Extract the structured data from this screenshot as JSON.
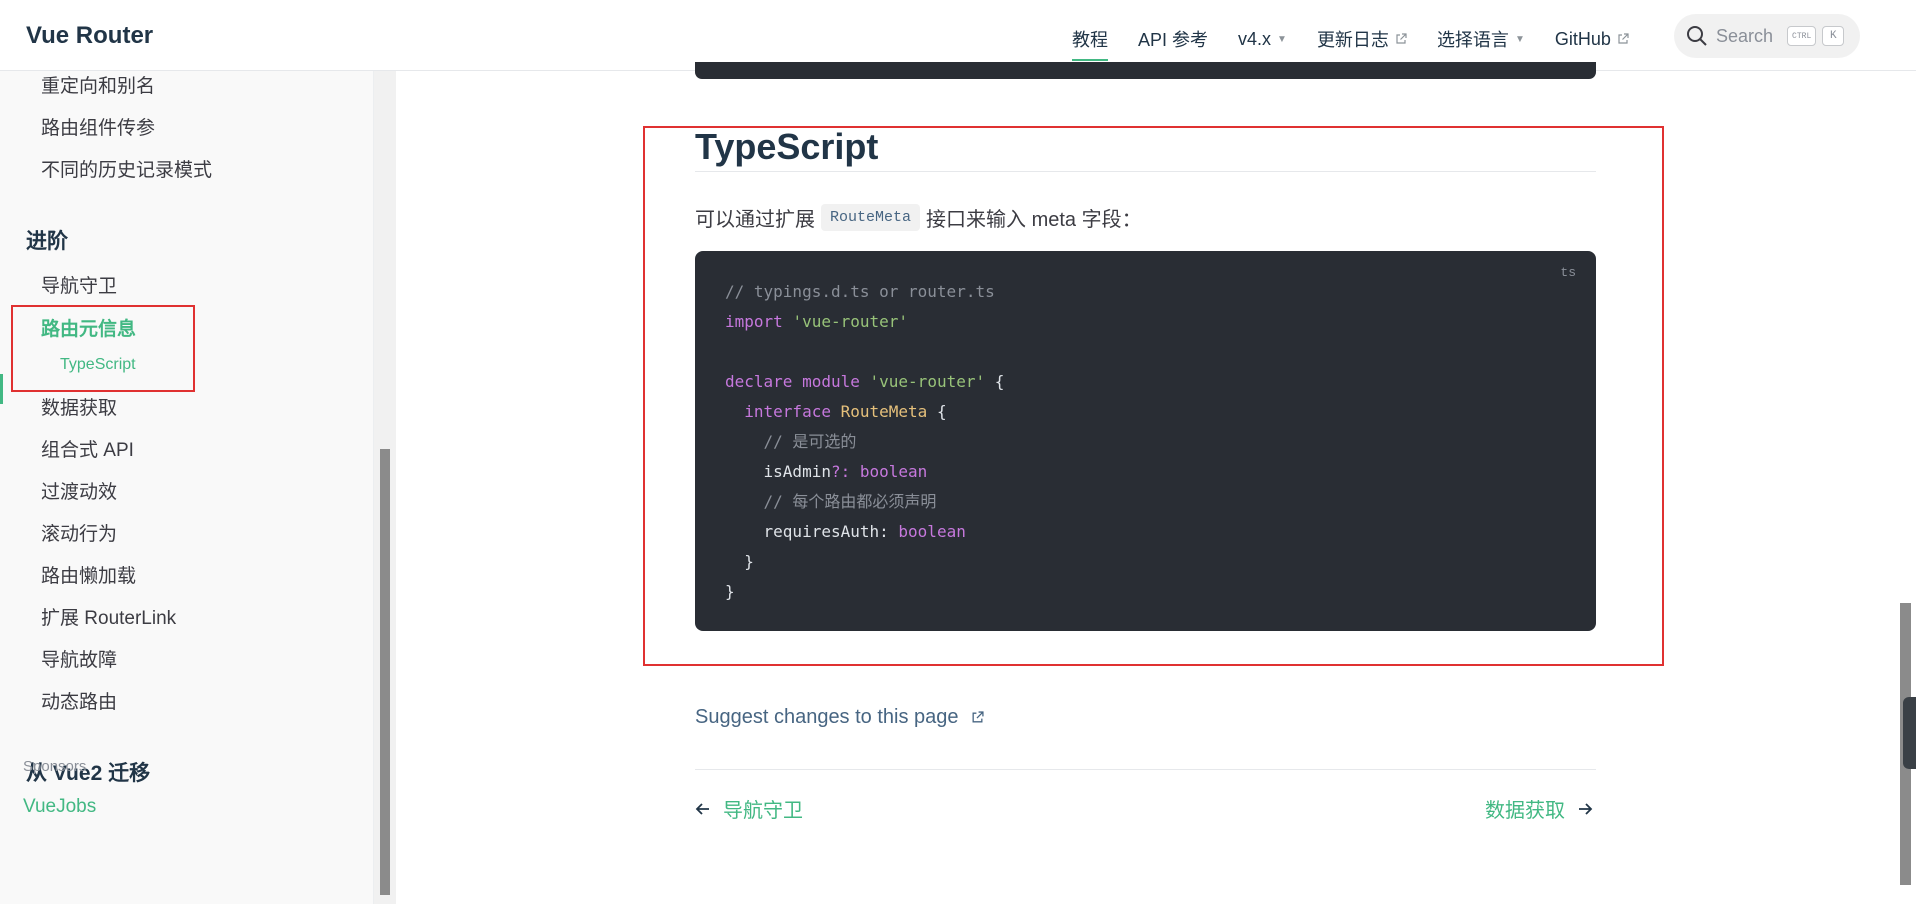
{
  "header": {
    "site_title": "Vue Router",
    "nav": [
      {
        "label": "教程",
        "active": true
      },
      {
        "label": "API 参考"
      },
      {
        "label": "v4.x",
        "dropdown": true
      },
      {
        "label": "更新日志",
        "external": true
      },
      {
        "label": "选择语言",
        "dropdown": true
      },
      {
        "label": "GitHub",
        "external": true
      }
    ],
    "search": {
      "placeholder": "Search",
      "key1": "CTRL",
      "key2": "K"
    }
  },
  "sidebar": {
    "items_top": [
      "重定向和别名",
      "路由组件传参",
      "不同的历史记录模式"
    ],
    "group_advanced": "进阶",
    "advanced_items": [
      "导航守卫",
      "路由元信息",
      "数据获取",
      "组合式 API",
      "过渡动效",
      "滚动行为",
      "路由懒加载",
      "扩展 RouterLink",
      "导航故障",
      "动态路由"
    ],
    "active_sub": "TypeScript",
    "group_migration": "从 Vue2 迁移",
    "sponsors_label": "Sponsors",
    "sponsor": "VueJobs"
  },
  "main": {
    "heading": "TypeScript",
    "para_before": "可以通过扩展",
    "para_code": "RouteMeta",
    "para_after": "接口来输入 meta 字段：",
    "code_lang": "ts",
    "code": {
      "l1": "// typings.d.ts or router.ts",
      "l2_kw": "import",
      "l2_str": "'vue-router'",
      "l4_kw1": "declare",
      "l4_kw2": "module",
      "l4_str": "'vue-router'",
      "l4_brace": "{",
      "l5_kw": "interface",
      "l5_type": "RouteMeta",
      "l5_brace": "{",
      "l6": "// 是可选的",
      "l7_prop": "isAdmin",
      "l7_op": "?:",
      "l7_type": "boolean",
      "l8": "// 每个路由都必须声明",
      "l9_prop": "requiresAuth",
      "l9_op": ":",
      "l9_type": "boolean",
      "l10": "}",
      "l11": "}"
    },
    "suggest": "Suggest changes to this page",
    "prev": "导航守卫",
    "next": "数据获取"
  }
}
